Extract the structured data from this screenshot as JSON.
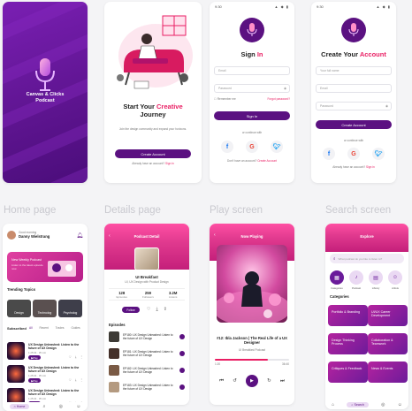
{
  "sections": {
    "home": "Home page",
    "details": "Details page",
    "play": "Play screen",
    "search": "Search screen"
  },
  "splash": {
    "title_line1": "Canvas & Clicks",
    "title_line2": "Podcast"
  },
  "onboarding": {
    "title_pre": "Start Your ",
    "title_accent": "Creative",
    "title_post": "Journey",
    "subtitle": "Join the design community and expand your horizons.",
    "cta": "Create Account",
    "signin_prompt": "Already have an account?",
    "signin_link": "Sign in"
  },
  "signin": {
    "title_pre": "Sign ",
    "title_accent": "In",
    "email_placeholder": "Email",
    "password_placeholder": "Password",
    "remember": "Remember me",
    "forgot": "Forgot password?",
    "button": "Sign In",
    "or": "or continue with",
    "no_account": "Don't have an account?",
    "create_link": "Create Account"
  },
  "create": {
    "title_pre": "Create Your ",
    "title_accent": "Account",
    "name_placeholder": "Your full name",
    "email_placeholder": "Email",
    "password_placeholder": "Password",
    "button": "Create Account",
    "or": "or continue with",
    "have_account": "Already have an account?",
    "signin_link": "Sign in"
  },
  "home": {
    "greeting": "Good morning",
    "user": "Danny Wielstrang",
    "banner_title": "New Weekly Podcast",
    "banner_sub": "Listen to the latest episode now",
    "trending": "Trending Topics",
    "topics": [
      "Design",
      "Technolog",
      "Psycholog"
    ],
    "subscribed": "Subscribed",
    "filters": [
      "All",
      "Recent",
      "Trades",
      "Guides"
    ],
    "episodes": [
      {
        "title": "UX Design Unleashed: Listen to the future of UX Design",
        "meta": "1:25:04 · 35 min",
        "play": "Play"
      },
      {
        "title": "UX Design Unleashed: Listen to the future of UX Design",
        "meta": "1:25:04 · 35 min",
        "play": "Play"
      },
      {
        "title": "UX Design Unleashed: Listen to the future of UX Design",
        "meta": "1:25:04 · 35 min",
        "play": "Play"
      }
    ],
    "nav": [
      "Home",
      "Search",
      "Library",
      "Profile"
    ]
  },
  "details": {
    "header": "Podcast Detail",
    "name": "UI Breakfast",
    "sub": "UI, UX Design with Product Design",
    "stats": [
      {
        "value": "128",
        "label": "Episodes"
      },
      {
        "value": "259",
        "label": "Followers"
      },
      {
        "value": "3.2M",
        "label": "Listens"
      }
    ],
    "follow": "Follow",
    "episodes_label": "Episodes",
    "episodes": [
      "EP180: UX Design Unleashed: Listen to the future of UX Design",
      "EP181: UX Design Unleashed: Listen to the future of UX Design",
      "EP182: UX Design Unleashed: Listen to the future of UX Design",
      "EP183: UX Design Unleashed: Listen to the future of UX Design"
    ]
  },
  "play": {
    "header": "Now Playing",
    "title": "#12: Ibla Jackson | The Real Life of a UX Designer",
    "artist": "UI Breakfast Podcast",
    "elapsed": "1:20",
    "total": "36:40",
    "progress": 0.72
  },
  "search": {
    "header": "Explore",
    "placeholder": "What podcast do you like to listen to?",
    "categories_label": "Categories",
    "circles": [
      "Categories",
      "Podcast",
      "Library",
      "Artists"
    ],
    "tiles": [
      "Portfolio & Branding",
      "UI/UX Career Development",
      "Design Thinking Process",
      "Collaboration & Teamwork",
      "Critiques & Feedback",
      "News & Events"
    ],
    "nav": [
      "Home",
      "Search",
      "Library",
      "Profile"
    ]
  },
  "colors": {
    "purple": "#5b1181",
    "pink": "#e91e63"
  }
}
